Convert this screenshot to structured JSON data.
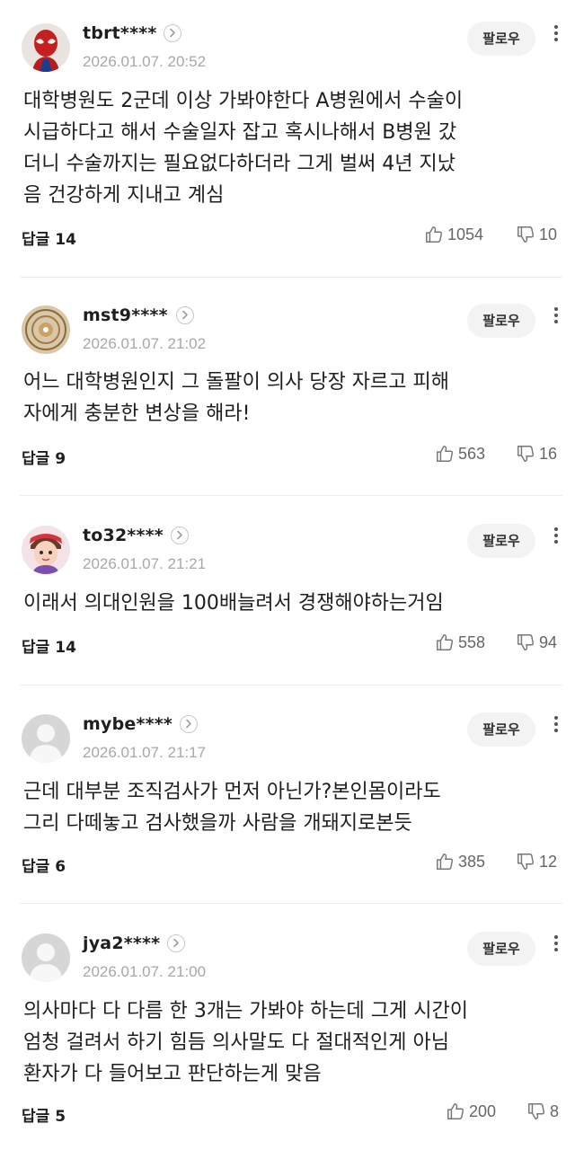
{
  "follow_label": "팔로우",
  "reply_label": "답글",
  "comments": [
    {
      "nickname": "tbrt****",
      "avatar": "spiderman-avatar",
      "date": "2026.01.07. 20:52",
      "lines": [
        "대학병원도 2군데 이상 가봐야한다 A병원에서 수술이",
        "시급하다고 해서 수술일자 잡고 혹시나해서 B병원 갔",
        "더니 수술까지는 필요없다하더라 그게 벌써 4년 지났",
        "음 건강하게 지내고 계심"
      ],
      "replies": "14",
      "likes": "1054",
      "dislikes": "10"
    },
    {
      "nickname": "mst9****",
      "avatar": "mandala-avatar",
      "date": "2026.01.07. 21:02",
      "lines": [
        "어느 대학병원인지 그 돌팔이 의사 당장 자르고 피해",
        "자에게 충분한 변상을 해라!"
      ],
      "replies": "9",
      "likes": "563",
      "dislikes": "16"
    },
    {
      "nickname": "to32****",
      "avatar": "cartoon-boy-avatar",
      "date": "2026.01.07. 21:21",
      "lines": [
        "이래서 의대인원을 100배늘려서 경쟁해야하는거임"
      ],
      "replies": "14",
      "likes": "558",
      "dislikes": "94"
    },
    {
      "nickname": "mybe****",
      "avatar": "default-avatar",
      "date": "2026.01.07. 21:17",
      "lines": [
        "근데 대부분 조직검사가 먼저 아닌가?본인몸이라도",
        "그리 다떼놓고 검사했을까 사람을 개돼지로본듯"
      ],
      "replies": "6",
      "likes": "385",
      "dislikes": "12"
    },
    {
      "nickname": "jya2****",
      "avatar": "default-avatar",
      "date": "2026.01.07. 21:00",
      "lines": [
        "의사마다 다 다름 한 3개는 가봐야 하는데 그게 시간이",
        "엄청 걸려서 하기 힘듬 의사말도 다 절대적인게 아님",
        "환자가 다 들어보고 판단하는게 맞음"
      ],
      "replies": "5",
      "likes": "200",
      "dislikes": "8"
    }
  ]
}
